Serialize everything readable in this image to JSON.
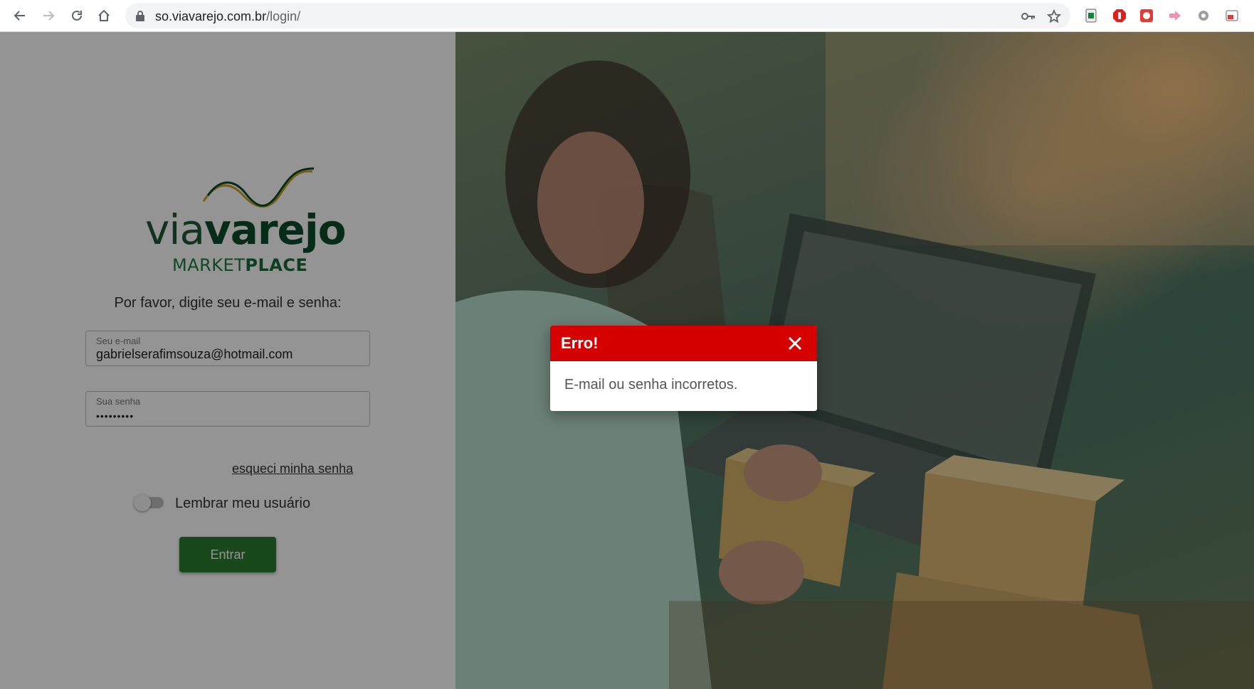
{
  "browser": {
    "url_host": "so.viavarejo.com.br",
    "url_path": "/login/"
  },
  "logo": {
    "brand_light": "via",
    "brand_bold": "varejo",
    "sub_light": "MARKET",
    "sub_bold": "PLACE"
  },
  "login": {
    "prompt": "Por favor, digite seu e-mail e senha:",
    "email_label": "Seu e-mail",
    "email_value": "gabrielserafimsouza@hotmail.com",
    "password_label": "Sua senha",
    "password_masked": "•••••••••",
    "forgot_link": "esqueci minha senha",
    "remember_label": "Lembrar meu usuário",
    "submit_label": "Entrar"
  },
  "dialog": {
    "title": "Erro!",
    "message": "E-mail ou senha incorretos."
  },
  "colors": {
    "accent_green": "#2e7d32",
    "error_red": "#d50000"
  }
}
